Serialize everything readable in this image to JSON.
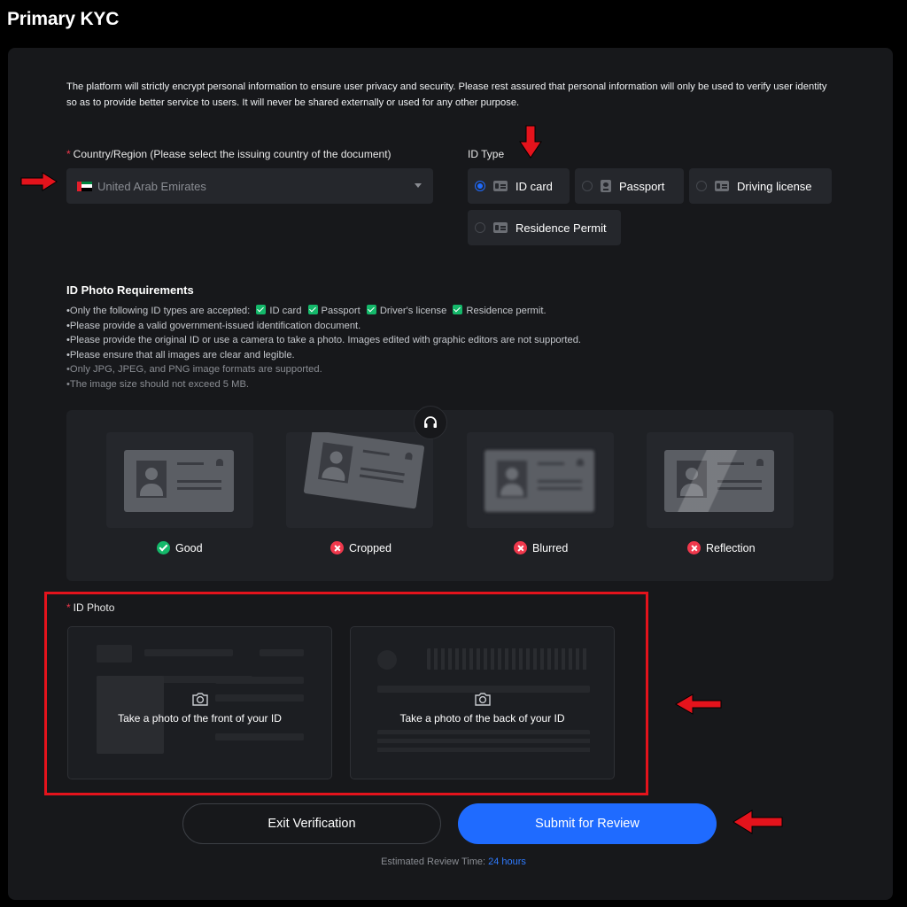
{
  "page": {
    "title": "Primary KYC"
  },
  "notice": "The platform will strictly encrypt personal information to ensure user privacy and security. Please rest assured that personal information will only be used to verify user identity so as to provide better service to users. It will never be shared externally or used for any other purpose.",
  "country": {
    "required_mark": "*",
    "label": "Country/Region (Please select the issuing country of the document)",
    "value": "United Arab Emirates",
    "flag_colors": {
      "hoist": "#e41e2b",
      "bands": [
        "#00843d",
        "#ffffff",
        "#000000"
      ]
    }
  },
  "id_type": {
    "label": "ID Type",
    "selected": "ID card",
    "options": [
      {
        "label": "ID card",
        "icon": "id-card-icon"
      },
      {
        "label": "Passport",
        "icon": "passport-icon"
      },
      {
        "label": "Driving license",
        "icon": "driving-license-icon"
      },
      {
        "label": "Residence Permit",
        "icon": "residence-permit-icon"
      }
    ]
  },
  "requirements": {
    "title": "ID Photo Requirements",
    "accepted_prefix": "•Only the following ID types are accepted:",
    "accepted_types": [
      "ID card",
      "Passport",
      "Driver's license",
      "Residence permit."
    ],
    "lines": [
      "•Please provide a valid government-issued identification document.",
      "•Please provide the original ID or use a camera to take a photo. Images edited with graphic editors are not supported.",
      "•Please ensure that all images are clear and legible.",
      "•Only JPG, JPEG, and PNG image formats are supported.",
      "•The image size should not exceed 5 MB."
    ]
  },
  "examples": [
    {
      "label": "Good",
      "status": "ok"
    },
    {
      "label": "Cropped",
      "status": "bad"
    },
    {
      "label": "Blurred",
      "status": "bad"
    },
    {
      "label": "Reflection",
      "status": "bad"
    }
  ],
  "id_photo": {
    "required_mark": "*",
    "label": "ID Photo",
    "front_text": "Take a photo of the front of your ID",
    "back_text": "Take a photo of the back of your ID"
  },
  "actions": {
    "exit_label": "Exit Verification",
    "submit_label": "Submit for Review",
    "review_prefix": "Estimated Review Time:",
    "review_value": "24 hours"
  },
  "colors": {
    "accent": "#1f6bff",
    "success": "#14b86a",
    "error": "#f0384c",
    "annotation": "#e4131c"
  }
}
